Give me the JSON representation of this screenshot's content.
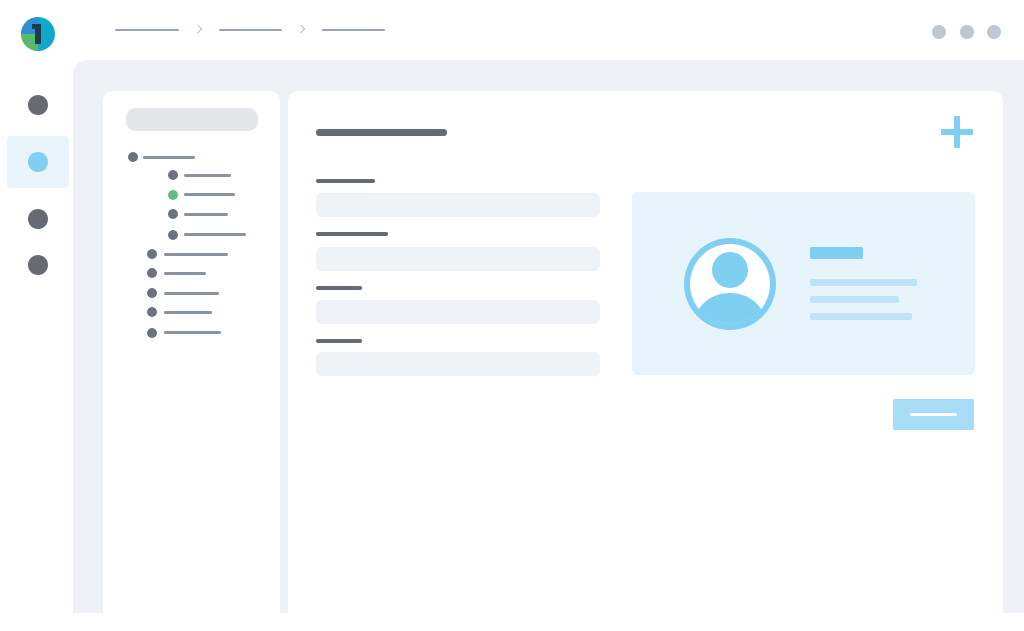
{
  "colors": {
    "accent": "#7ecff2",
    "accent_light": "#e8f4fb",
    "button": "#a6dcf6",
    "status_green": "#5cbf7a",
    "placeholder_dark": "#646b75",
    "background_gray": "#eef1f5"
  },
  "icons": {
    "logo": "app-logo-icon",
    "add": "plus-icon",
    "avatar": "user-avatar-icon",
    "window_controls": [
      "window-dot-icon",
      "window-dot-icon",
      "window-dot-icon"
    ],
    "rail": [
      "nav-dot-icon",
      "nav-dot-icon",
      "nav-dot-icon",
      "nav-dot-icon"
    ]
  },
  "rail": {
    "active_index": 1
  },
  "tree": {
    "selected_item_index": 1
  }
}
